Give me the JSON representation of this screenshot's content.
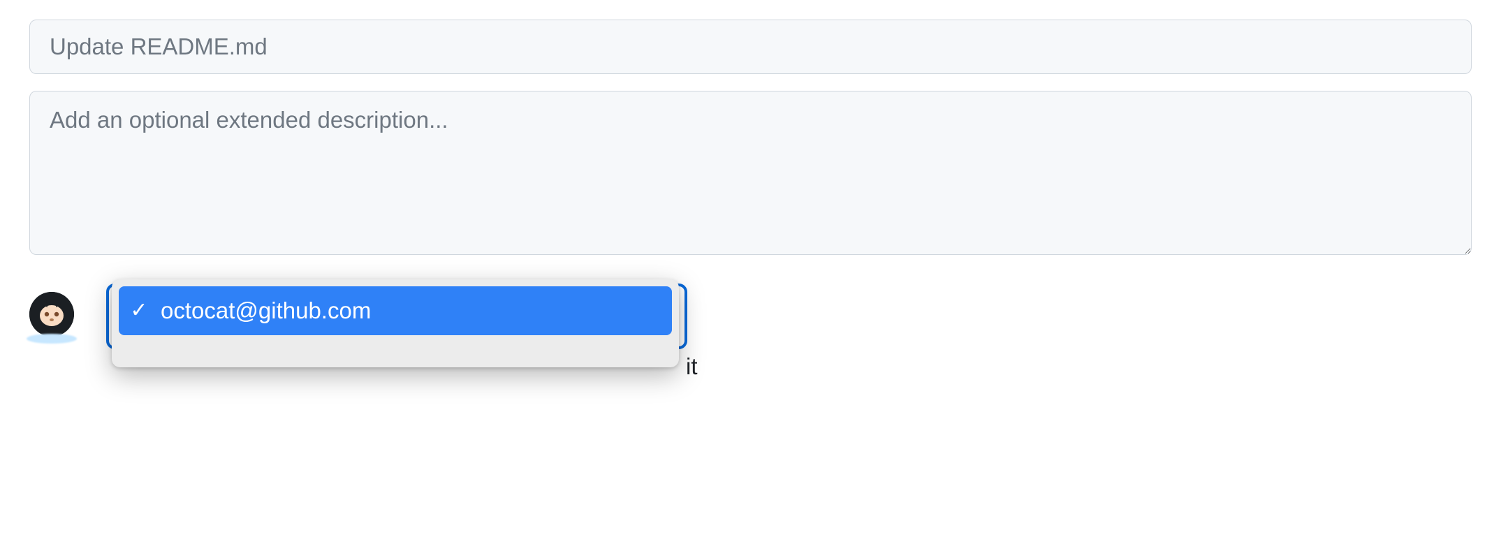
{
  "commit_form": {
    "title_placeholder": "Update README.md",
    "title_value": "",
    "description_placeholder": "Add an optional extended description...",
    "description_value": ""
  },
  "author_dropdown": {
    "options": [
      {
        "label": "octocat@github.com",
        "selected": true
      }
    ]
  },
  "truncated_trailing_text": "it",
  "icons": {
    "check": "✓"
  }
}
